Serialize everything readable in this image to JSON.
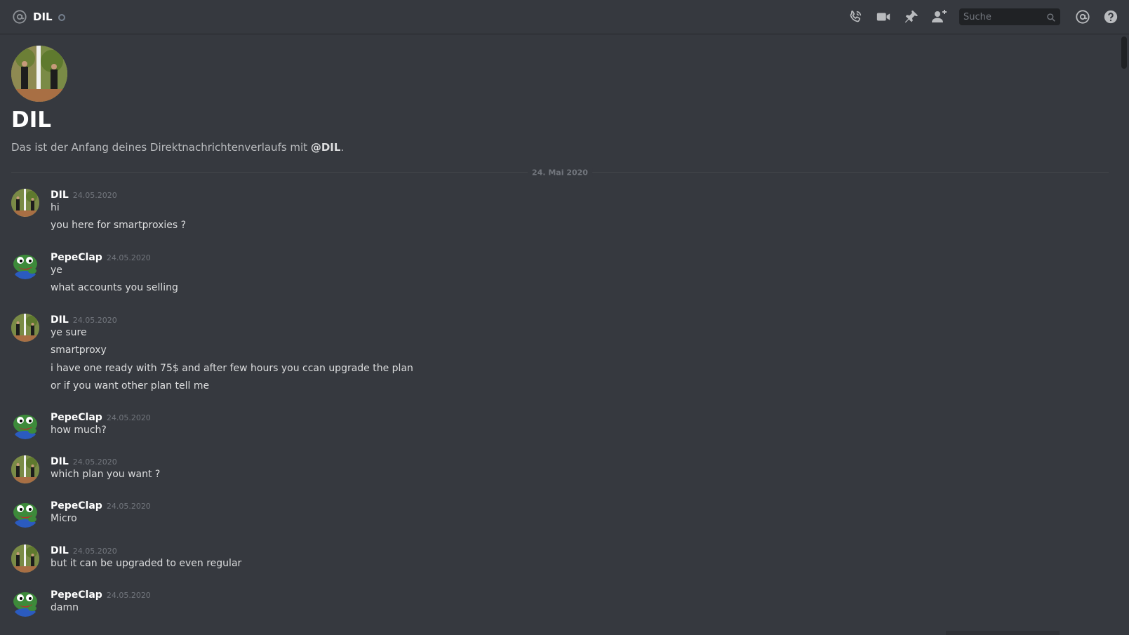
{
  "header": {
    "channel_name": "DIL",
    "search_placeholder": "Suche",
    "icons": [
      "at-icon",
      "status-icon",
      "phone-icon",
      "video-icon",
      "pin-icon",
      "add-member-icon",
      "search-icon",
      "mention-icon",
      "help-icon"
    ]
  },
  "intro": {
    "title": "DIL",
    "subtitle_prefix": "Das ist der Anfang deines Direktnachrichtenverlaufs mit ",
    "subtitle_mention": "@DIL",
    "subtitle_suffix": "."
  },
  "date_divider": "24. Mai 2020",
  "messages": [
    {
      "author": "DIL",
      "timestamp": "24.05.2020",
      "lines": [
        "hi",
        "you here for smartproxies ?"
      ]
    },
    {
      "author": "PepeClap",
      "timestamp": "24.05.2020",
      "lines": [
        "ye",
        "what accounts you selling"
      ]
    },
    {
      "author": "DIL",
      "timestamp": "24.05.2020",
      "lines": [
        "ye sure",
        "smartproxy",
        "i have one ready with 75$ and after few hours you ccan upgrade the plan",
        "or if you want other plan tell me"
      ]
    },
    {
      "author": "PepeClap",
      "timestamp": "24.05.2020",
      "lines": [
        "how much?"
      ]
    },
    {
      "author": "DIL",
      "timestamp": "24.05.2020",
      "lines": [
        "which plan you want ?"
      ]
    },
    {
      "author": "PepeClap",
      "timestamp": "24.05.2020",
      "lines": [
        "Micro"
      ]
    },
    {
      "author": "DIL",
      "timestamp": "24.05.2020",
      "lines": [
        "but it can be upgraded to even regular"
      ]
    },
    {
      "author": "PepeClap",
      "timestamp": "24.05.2020",
      "lines": [
        "damn"
      ]
    }
  ],
  "colors": {
    "background": "#36393f",
    "author": "#ffffff",
    "text": "#dcddde",
    "timestamp": "#72767d"
  }
}
